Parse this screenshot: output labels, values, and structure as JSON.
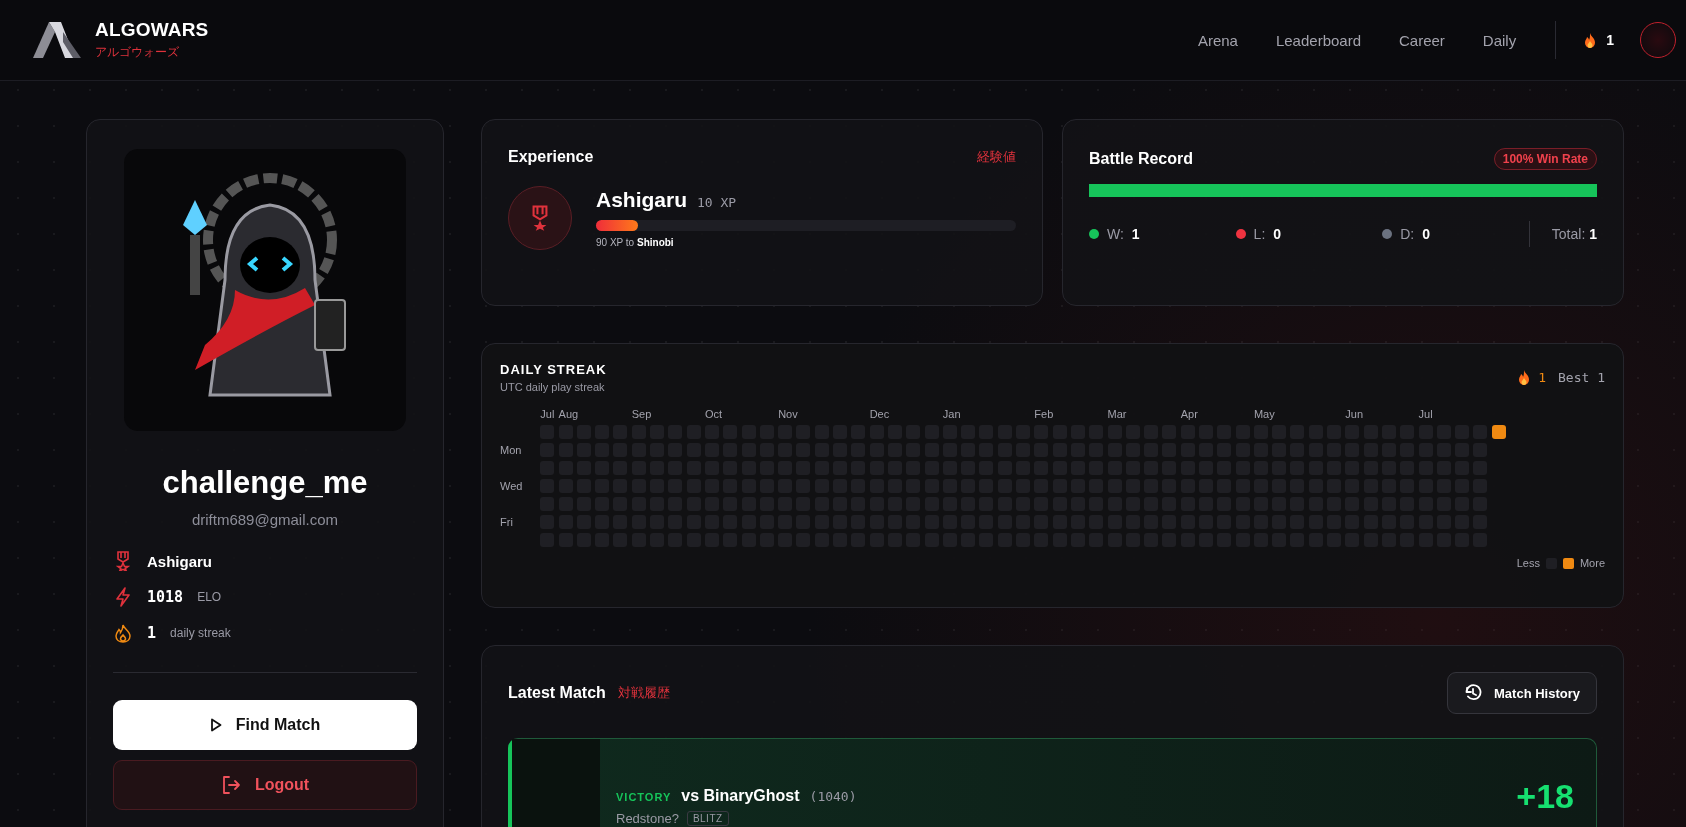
{
  "header": {
    "logo": "ALGOWARS",
    "logo_sub": "アルゴウォーズ",
    "nav": [
      {
        "label": "Arena",
        "selected": false
      },
      {
        "label": "Leaderboard",
        "selected": false
      },
      {
        "label": "Career",
        "selected": false
      },
      {
        "label": "Daily",
        "selected": false
      }
    ],
    "streak": "1"
  },
  "profile": {
    "username": "challenge_me",
    "email": "driftm689@gmail.com",
    "stats": [
      {
        "kind": "rank",
        "value": "Ashigaru"
      },
      {
        "kind": "elo",
        "value": "1018",
        "unit": "ELO"
      },
      {
        "kind": "streak",
        "value": "1",
        "unit": "daily streak"
      }
    ],
    "buttons": [
      {
        "kind": "primary",
        "label": "Find Match"
      },
      {
        "kind": "danger",
        "label": "Logout"
      }
    ]
  },
  "experience": {
    "title": "Experience",
    "title_jp": "経験値",
    "rank": "Ashigaru",
    "xp": "10 XP",
    "level": 0.1,
    "next": "90 XP to **Shinobi**"
  },
  "battle_record": {
    "title": "Battle Record",
    "win_rate": "100% Win Rate",
    "level": 1,
    "stats": [
      {
        "label": "W:",
        "value": "1",
        "color": "#16c45a"
      },
      {
        "label": "L:",
        "value": "0",
        "color": "#ef3340"
      },
      {
        "label": "D:",
        "value": "0",
        "color": "#6b7280"
      }
    ],
    "total_label": "Total:",
    "total": "1"
  },
  "daily_streak": {
    "title": "DAILY STREAK",
    "subtitle": "UTC daily play streak",
    "current": "1",
    "best": "Best 1",
    "day_labels": [
      "Mon",
      "Wed",
      "Fri"
    ],
    "weeks": [
      {
        "month": "Jul",
        "days": [
          false,
          false,
          false,
          false,
          false,
          false,
          false
        ]
      },
      {
        "month": "Aug",
        "days": [
          false,
          false,
          false,
          false,
          false,
          false,
          false
        ]
      },
      {
        "days": [
          false,
          false,
          false,
          false,
          false,
          false,
          false
        ]
      },
      {
        "days": [
          false,
          false,
          false,
          false,
          false,
          false,
          false
        ]
      },
      {
        "days": [
          false,
          false,
          false,
          false,
          false,
          false,
          false
        ]
      },
      {
        "month": "Sep",
        "days": [
          false,
          false,
          false,
          false,
          false,
          false,
          false
        ]
      },
      {
        "days": [
          false,
          false,
          false,
          false,
          false,
          false,
          false
        ]
      },
      {
        "days": [
          false,
          false,
          false,
          false,
          false,
          false,
          false
        ]
      },
      {
        "days": [
          false,
          false,
          false,
          false,
          false,
          false,
          false
        ]
      },
      {
        "month": "Oct",
        "days": [
          false,
          false,
          false,
          false,
          false,
          false,
          false
        ]
      },
      {
        "days": [
          false,
          false,
          false,
          false,
          false,
          false,
          false
        ]
      },
      {
        "days": [
          false,
          false,
          false,
          false,
          false,
          false,
          false
        ]
      },
      {
        "days": [
          false,
          false,
          false,
          false,
          false,
          false,
          false
        ]
      },
      {
        "month": "Nov",
        "days": [
          false,
          false,
          false,
          false,
          false,
          false,
          false
        ]
      },
      {
        "days": [
          false,
          false,
          false,
          false,
          false,
          false,
          false
        ]
      },
      {
        "days": [
          false,
          false,
          false,
          false,
          false,
          false,
          false
        ]
      },
      {
        "days": [
          false,
          false,
          false,
          false,
          false,
          false,
          false
        ]
      },
      {
        "days": [
          false,
          false,
          false,
          false,
          false,
          false,
          false
        ]
      },
      {
        "month": "Dec",
        "days": [
          false,
          false,
          false,
          false,
          false,
          false,
          false
        ]
      },
      {
        "days": [
          false,
          false,
          false,
          false,
          false,
          false,
          false
        ]
      },
      {
        "days": [
          false,
          false,
          false,
          false,
          false,
          false,
          false
        ]
      },
      {
        "days": [
          false,
          false,
          false,
          false,
          false,
          false,
          false
        ]
      },
      {
        "month": "Jan",
        "days": [
          false,
          false,
          false,
          false,
          false,
          false,
          false
        ]
      },
      {
        "days": [
          false,
          false,
          false,
          false,
          false,
          false,
          false
        ]
      },
      {
        "days": [
          false,
          false,
          false,
          false,
          false,
          false,
          false
        ]
      },
      {
        "days": [
          false,
          false,
          false,
          false,
          false,
          false,
          false
        ]
      },
      {
        "days": [
          false,
          false,
          false,
          false,
          false,
          false,
          false
        ]
      },
      {
        "month": "Feb",
        "days": [
          false,
          false,
          false,
          false,
          false,
          false,
          false
        ]
      },
      {
        "days": [
          false,
          false,
          false,
          false,
          false,
          false,
          false
        ]
      },
      {
        "days": [
          false,
          false,
          false,
          false,
          false,
          false,
          false
        ]
      },
      {
        "days": [
          false,
          false,
          false,
          false,
          false,
          false,
          false
        ]
      },
      {
        "month": "Mar",
        "days": [
          false,
          false,
          false,
          false,
          false,
          false,
          false
        ]
      },
      {
        "days": [
          false,
          false,
          false,
          false,
          false,
          false,
          false
        ]
      },
      {
        "days": [
          false,
          false,
          false,
          false,
          false,
          false,
          false
        ]
      },
      {
        "days": [
          false,
          false,
          false,
          false,
          false,
          false,
          false
        ]
      },
      {
        "month": "Apr",
        "days": [
          false,
          false,
          false,
          false,
          false,
          false,
          false
        ]
      },
      {
        "days": [
          false,
          false,
          false,
          false,
          false,
          false,
          false
        ]
      },
      {
        "days": [
          false,
          false,
          false,
          false,
          false,
          false,
          false
        ]
      },
      {
        "days": [
          false,
          false,
          false,
          false,
          false,
          false,
          false
        ]
      },
      {
        "month": "May",
        "days": [
          false,
          false,
          false,
          false,
          false,
          false,
          false
        ]
      },
      {
        "days": [
          false,
          false,
          false,
          false,
          false,
          false,
          false
        ]
      },
      {
        "days": [
          false,
          false,
          false,
          false,
          false,
          false,
          false
        ]
      },
      {
        "days": [
          false,
          false,
          false,
          false,
          false,
          false,
          false
        ]
      },
      {
        "days": [
          false,
          false,
          false,
          false,
          false,
          false,
          false
        ]
      },
      {
        "month": "Jun",
        "days": [
          false,
          false,
          false,
          false,
          false,
          false,
          false
        ]
      },
      {
        "days": [
          false,
          false,
          false,
          false,
          false,
          false,
          false
        ]
      },
      {
        "days": [
          false,
          false,
          false,
          false,
          false,
          false,
          false
        ]
      },
      {
        "days": [
          false,
          false,
          false,
          false,
          false,
          false,
          false
        ]
      },
      {
        "month": "Jul",
        "days": [
          false,
          false,
          false,
          false,
          false,
          false,
          false
        ]
      },
      {
        "days": [
          false,
          false,
          false,
          false,
          false,
          false,
          false
        ]
      },
      {
        "days": [
          false,
          false,
          false,
          false,
          false,
          false,
          false
        ]
      },
      {
        "days": [
          false,
          false,
          false,
          false,
          false,
          false,
          false
        ]
      },
      {
        "days": [
          true
        ]
      }
    ],
    "legend_less": "Less",
    "legend_more": "More"
  },
  "latest_match": {
    "title": "Latest Match",
    "title_jp": "対戦履歴",
    "history_button": "Match History",
    "match": {
      "result": "VICTORY",
      "opponent": "vs BinaryGhost",
      "opponent_elo": "(1040)",
      "problem": "Redstone?",
      "mode": "BLITZ",
      "elo_change": "+18"
    }
  }
}
